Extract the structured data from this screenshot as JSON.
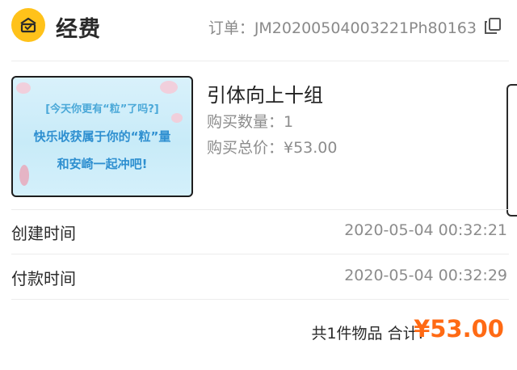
{
  "header": {
    "shop_name": "经费",
    "order_label": "订单：JM20200504003221Ph80163"
  },
  "product": {
    "title": "引体向上十组",
    "quantity_label": "购买数量：1",
    "total_label": "购买总价：¥53.00",
    "image": {
      "line1": "[今天你更有“粒”了吗?]",
      "line2": "快乐收获属于你的“粒”量",
      "line3": "和安崎一起冲吧!"
    }
  },
  "times": [
    {
      "label": "创建时间",
      "value": "2020-05-04 00:32:21"
    },
    {
      "label": "付款时间",
      "value": "2020-05-04 00:32:29"
    }
  ],
  "summary": {
    "count_label": "共1件物品 合计:",
    "amount": "¥53.00"
  },
  "colors": {
    "logo": "#ffc21a",
    "price": "#ff6a14",
    "muted_text": "#8c8c8c"
  },
  "icons": {
    "logo": "shop-logo-icon",
    "copy": "copy-icon"
  }
}
